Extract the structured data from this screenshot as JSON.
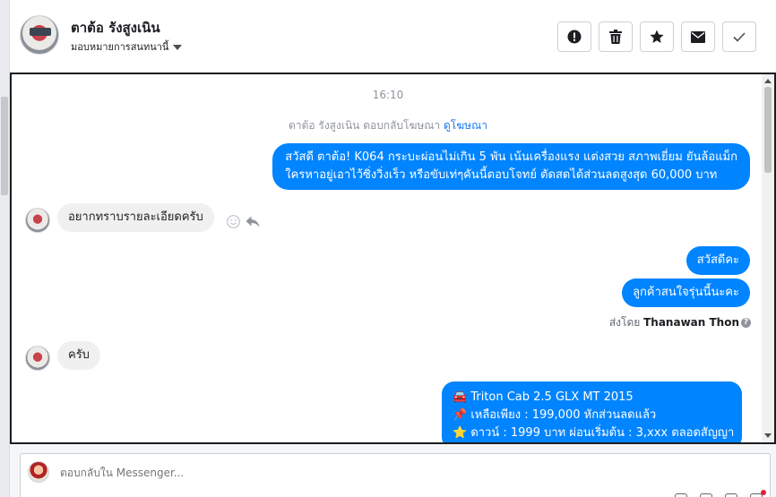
{
  "contact": {
    "name": "ตาต้อ รังสูงเนิน",
    "assign_label": "มอบหมายการสนทนานี้"
  },
  "header_actions": [
    {
      "icon": "alert-icon",
      "label": "Mark as spam"
    },
    {
      "icon": "trash-icon",
      "label": "Delete"
    },
    {
      "icon": "star-icon",
      "label": "Star"
    },
    {
      "icon": "envelope-icon",
      "label": "Mark unread"
    },
    {
      "icon": "check-icon",
      "label": "Mark done"
    }
  ],
  "conversation": {
    "time": "16:10",
    "reply_note": "ตาต้อ รังสูงเนิน ตอบกลับโฆษณา",
    "reply_link": "ดูโฆษณา",
    "messages": [
      {
        "side": "out",
        "lines": [
          "สวัสดี ตาต้อ! K064 กระบะผ่อนไม่เกิน 5 พัน เน้นเครื่องแรง แต่งสวย สภาพเยี่ยม ยันล้อแม็ก",
          "ใครหาอยู่เอาไว้ซิ่งวิ่งเร็ว หรือขับเท่ๆคันนี้ตอบโจทย์ ตัดสดได้ส่วนลดสูงสุด 60,000 บาท"
        ]
      },
      {
        "side": "in",
        "text": "อยากทราบรายละเอียดครับ"
      },
      {
        "side": "out",
        "text": "สวัสดีคะ"
      },
      {
        "side": "out",
        "text": "ลูกค้าสนใจรุ่นนี้นะคะ"
      },
      {
        "side": "in",
        "text": "ครับ"
      },
      {
        "side": "out",
        "lines": [
          "🚘 Triton Cab 2.5 GLX MT 2015",
          "📌 เหลือเพียง : 199,000 หักส่วนลดแล้ว",
          "⭐ ดาวน์ : 1999 บาท ผ่อนเริ่มต้น : 3,xxx ตลอดสัญญา"
        ]
      }
    ],
    "sent_by_prefix": "ส่งโดย",
    "sent_by_name": "Thanawan Thon"
  },
  "composer": {
    "placeholder": "ตอบกลับใน Messenger..."
  }
}
